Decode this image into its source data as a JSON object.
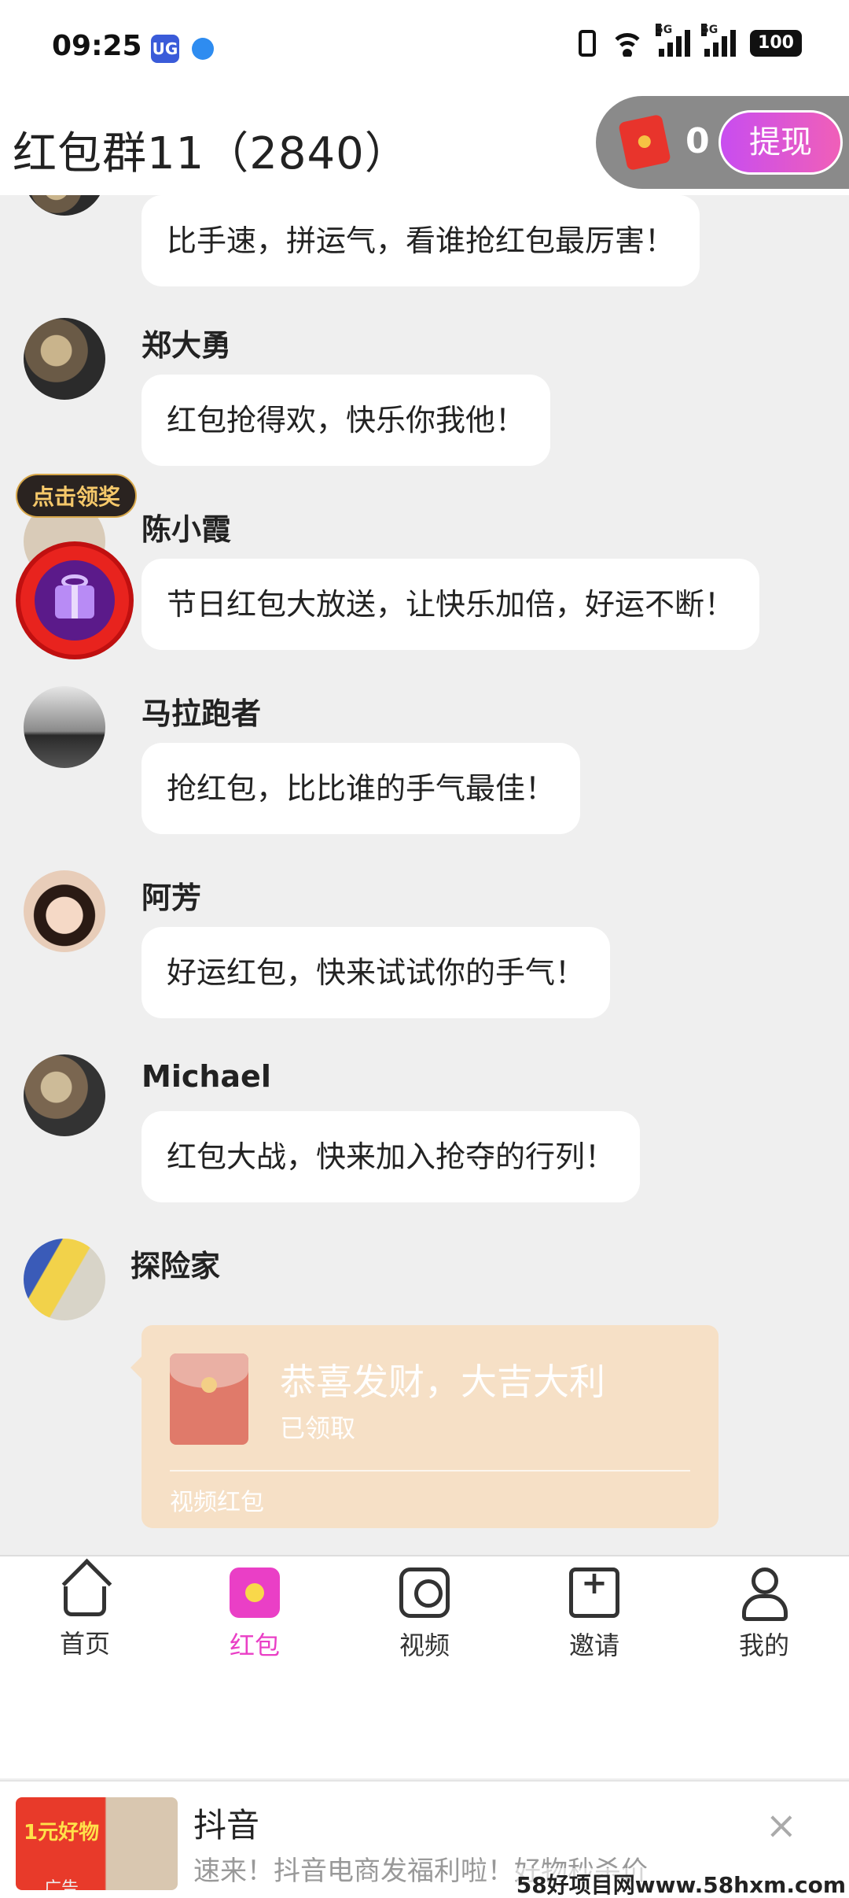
{
  "status_bar": {
    "time": "09:25",
    "app_icon_1": "UG",
    "signal_1": "5G",
    "signal_2": "5G",
    "battery": "100"
  },
  "header": {
    "title": "红包群11（2840）",
    "reward_count": "0",
    "withdraw_label": "提现"
  },
  "messages": [
    {
      "name": "",
      "text": "比手速，拼运气，看谁抢红包最厉害！"
    },
    {
      "name": "郑大勇",
      "text": "红包抢得欢，快乐你我他！"
    },
    {
      "name": "陈小霞",
      "text": "节日红包大放送，让快乐加倍，好运不断！"
    },
    {
      "name": "马拉跑者",
      "text": "抢红包，比比谁的手气最佳！"
    },
    {
      "name": "阿芳",
      "text": "好运红包，快来试试你的手气！"
    },
    {
      "name": "Michael",
      "text": "红包大战，快来加入抢夺的行列！"
    },
    {
      "name": "探险家",
      "text": ""
    }
  ],
  "prize_badge": "点击领奖",
  "red_packet": {
    "title": "恭喜发财，大吉大利",
    "status": "已领取",
    "type": "视频红包"
  },
  "tabs": [
    {
      "label": "首页",
      "icon": "home-icon"
    },
    {
      "label": "红包",
      "icon": "red-packet-icon"
    },
    {
      "label": "视频",
      "icon": "video-icon"
    },
    {
      "label": "邀请",
      "icon": "invite-icon"
    },
    {
      "label": "我的",
      "icon": "profile-icon"
    }
  ],
  "active_tab": "红包",
  "accent_color": "#ea3fc6",
  "ad": {
    "thumb_text": "1元好物",
    "tag": "广告",
    "title": "抖音",
    "subtitle": "速来！抖音电商发福利啦！好物秒杀价",
    "close": "×"
  },
  "watermark": "58好项目网www.58hxm.com"
}
